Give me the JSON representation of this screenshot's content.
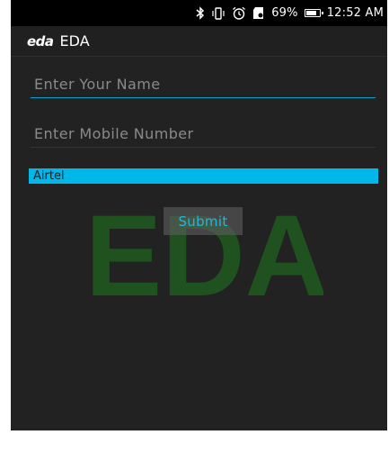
{
  "status_bar": {
    "icons": [
      "bluetooth-icon",
      "vibrate-icon",
      "alarm-icon",
      "sd-card-icon",
      "battery-icon"
    ],
    "battery_percent": "69%",
    "time": "12:52 AM"
  },
  "app": {
    "logo_text": "eda",
    "title": "EDA"
  },
  "form": {
    "name_placeholder": "Enter Your Name",
    "mobile_placeholder": "Enter Mobile Number",
    "operator_selected": "Airtel",
    "submit_label": "Submit"
  },
  "watermark": {
    "text": "EDA",
    "color": "#1e5a1e"
  },
  "colors": {
    "accent": "#0fa3c8",
    "spinner_bg": "#00b7ea",
    "background": "#222222",
    "status_bar": "#000000"
  }
}
